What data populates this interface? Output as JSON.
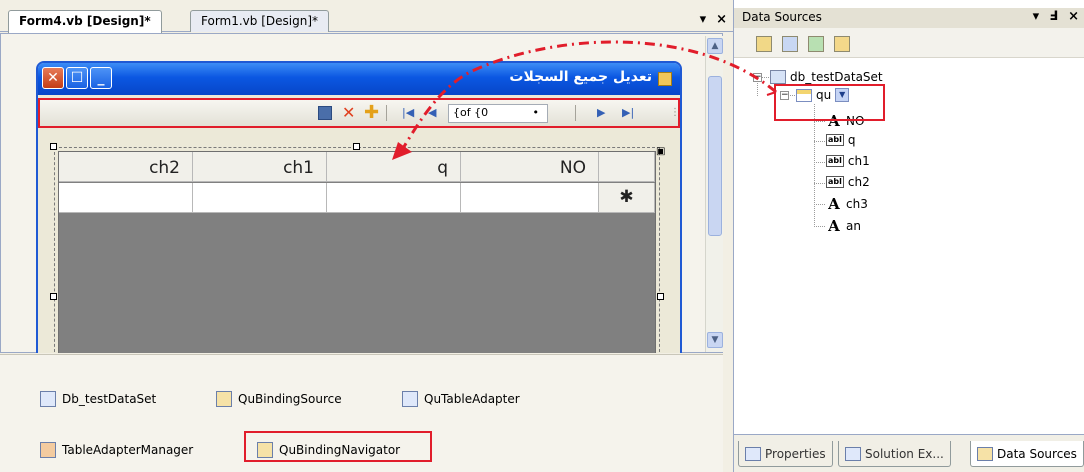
{
  "designer": {
    "tabs": [
      {
        "label": "Form4.vb [Design]*",
        "active": true
      },
      {
        "label": "Form1.vb [Design]*",
        "active": false
      }
    ],
    "tab_controls": {
      "dropdown": "▾",
      "close": "×"
    }
  },
  "form": {
    "title": "تعديل جميع السجلات",
    "window_buttons": {
      "close": "✕",
      "maximize": "☐",
      "minimize": "_"
    },
    "navigator": {
      "position_label": "{of {0",
      "position_dot": "•"
    },
    "grid": {
      "columns": [
        "ch2",
        "ch1",
        "q",
        "NO"
      ],
      "new_row_marker": "✱"
    }
  },
  "component_tray": {
    "items": [
      {
        "label": "Db_testDataSet"
      },
      {
        "label": "QuBindingSource"
      },
      {
        "label": "QuTableAdapter"
      },
      {
        "label": "TableAdapterManager"
      },
      {
        "label": "QuBindingNavigator"
      }
    ]
  },
  "data_sources": {
    "title": "Data Sources",
    "title_controls": {
      "dropdown": "▾",
      "pin": "Ⅎ",
      "close": "×"
    },
    "tree": {
      "dataset": "db_testDataSet",
      "table": "qu",
      "fields": [
        {
          "name": "NO",
          "control": "label"
        },
        {
          "name": "q",
          "control": "textbox"
        },
        {
          "name": "ch1",
          "control": "textbox"
        },
        {
          "name": "ch2",
          "control": "textbox"
        },
        {
          "name": "ch3",
          "control": "label"
        },
        {
          "name": "an",
          "control": "label"
        }
      ],
      "textbox_icon_text": "abl",
      "label_icon_text": "A"
    },
    "bottom_tabs": [
      {
        "label": "Properties",
        "active": false
      },
      {
        "label": "Solution Ex...",
        "active": false
      },
      {
        "label": "Data Sources",
        "active": true
      }
    ]
  },
  "colors": {
    "highlight_red": "#e11d2b",
    "xp_title_blue": "#0b57e2",
    "grid_background": "#808080"
  }
}
